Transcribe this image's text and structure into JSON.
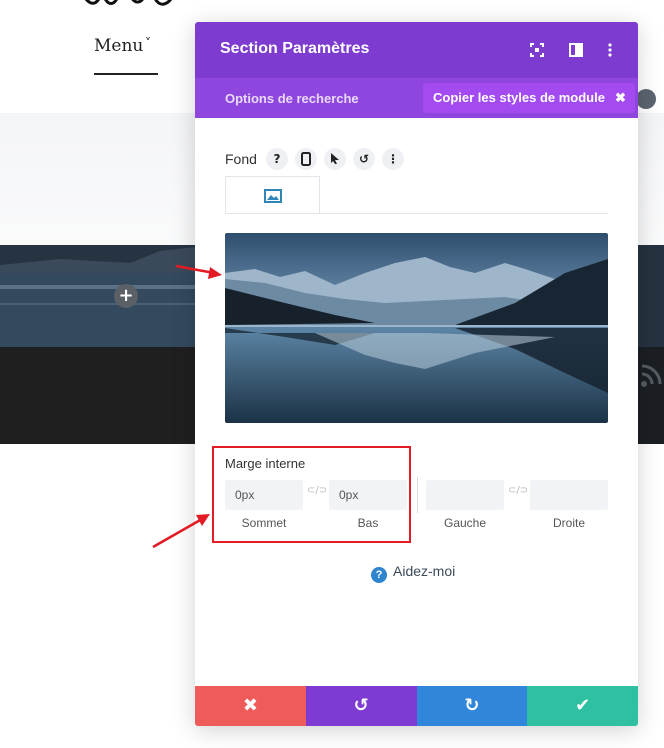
{
  "site": {
    "menu_label": "Menu",
    "menu_chevron": "˅",
    "add_button": "+"
  },
  "modal": {
    "title": "Section Paramètres",
    "header_icons": [
      "expand-icon",
      "split-view-icon",
      "more-vertical-icon"
    ],
    "subbar": {
      "tab_label": "Options de recherche",
      "copy_button": "Copier les styles de module",
      "copy_close": "✖"
    },
    "background": {
      "label": "Fond",
      "tools": [
        "?",
        "📱",
        "➤",
        "↺",
        "⋮"
      ],
      "tab_icon": "image-icon"
    },
    "padding": {
      "label": "Marge interne",
      "fields": [
        {
          "value": "0px",
          "caption": "Sommet"
        },
        {
          "value": "0px",
          "caption": "Bas"
        },
        {
          "value": "",
          "caption": "Gauche"
        },
        {
          "value": "",
          "caption": "Droite"
        }
      ]
    },
    "help_label": "Aidez-moi",
    "footer": {
      "cancel": "✖",
      "undo": "↺",
      "redo": "↻",
      "save": "✔"
    }
  },
  "colors": {
    "header": "#7e3bd0",
    "subbar": "#8f46de",
    "copy_button": "#a34bf0",
    "cancel": "#ef5a5a",
    "undo": "#7d3bd3",
    "redo": "#2f86da",
    "save": "#2ec0a0",
    "highlight": "#e21b24"
  }
}
